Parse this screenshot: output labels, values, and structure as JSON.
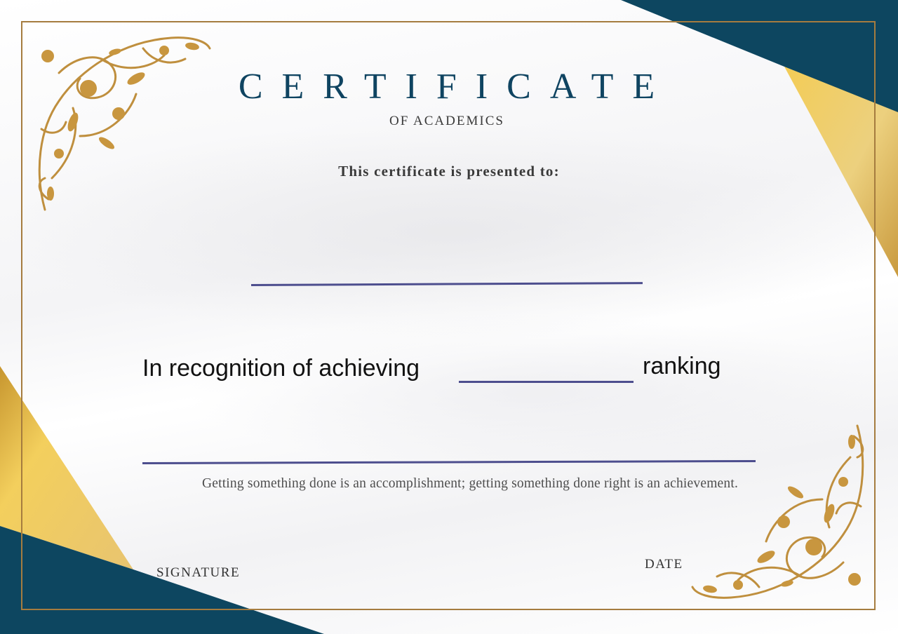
{
  "certificate": {
    "title": "CERTIFICATE",
    "subtitle": "OF ACADEMICS",
    "presented_to": "This certificate is presented to:",
    "recognition_text": "In recognition of achieving",
    "ranking_text": "ranking",
    "quote": "Getting something done is an accomplishment; getting something done right is an achievement.",
    "signature_label": "SIGNATURE",
    "date_label": "DATE"
  },
  "colors": {
    "navy": "#0d4660",
    "gold": "#e9c05a",
    "gold_dark": "#b98a3a",
    "frame": "#a57c3f",
    "fill_line": "#4d4e8e",
    "title": "#0f4461"
  },
  "icons": {
    "top_left_ornament": "floral-corner-ornament",
    "bottom_right_ornament": "floral-corner-ornament"
  }
}
